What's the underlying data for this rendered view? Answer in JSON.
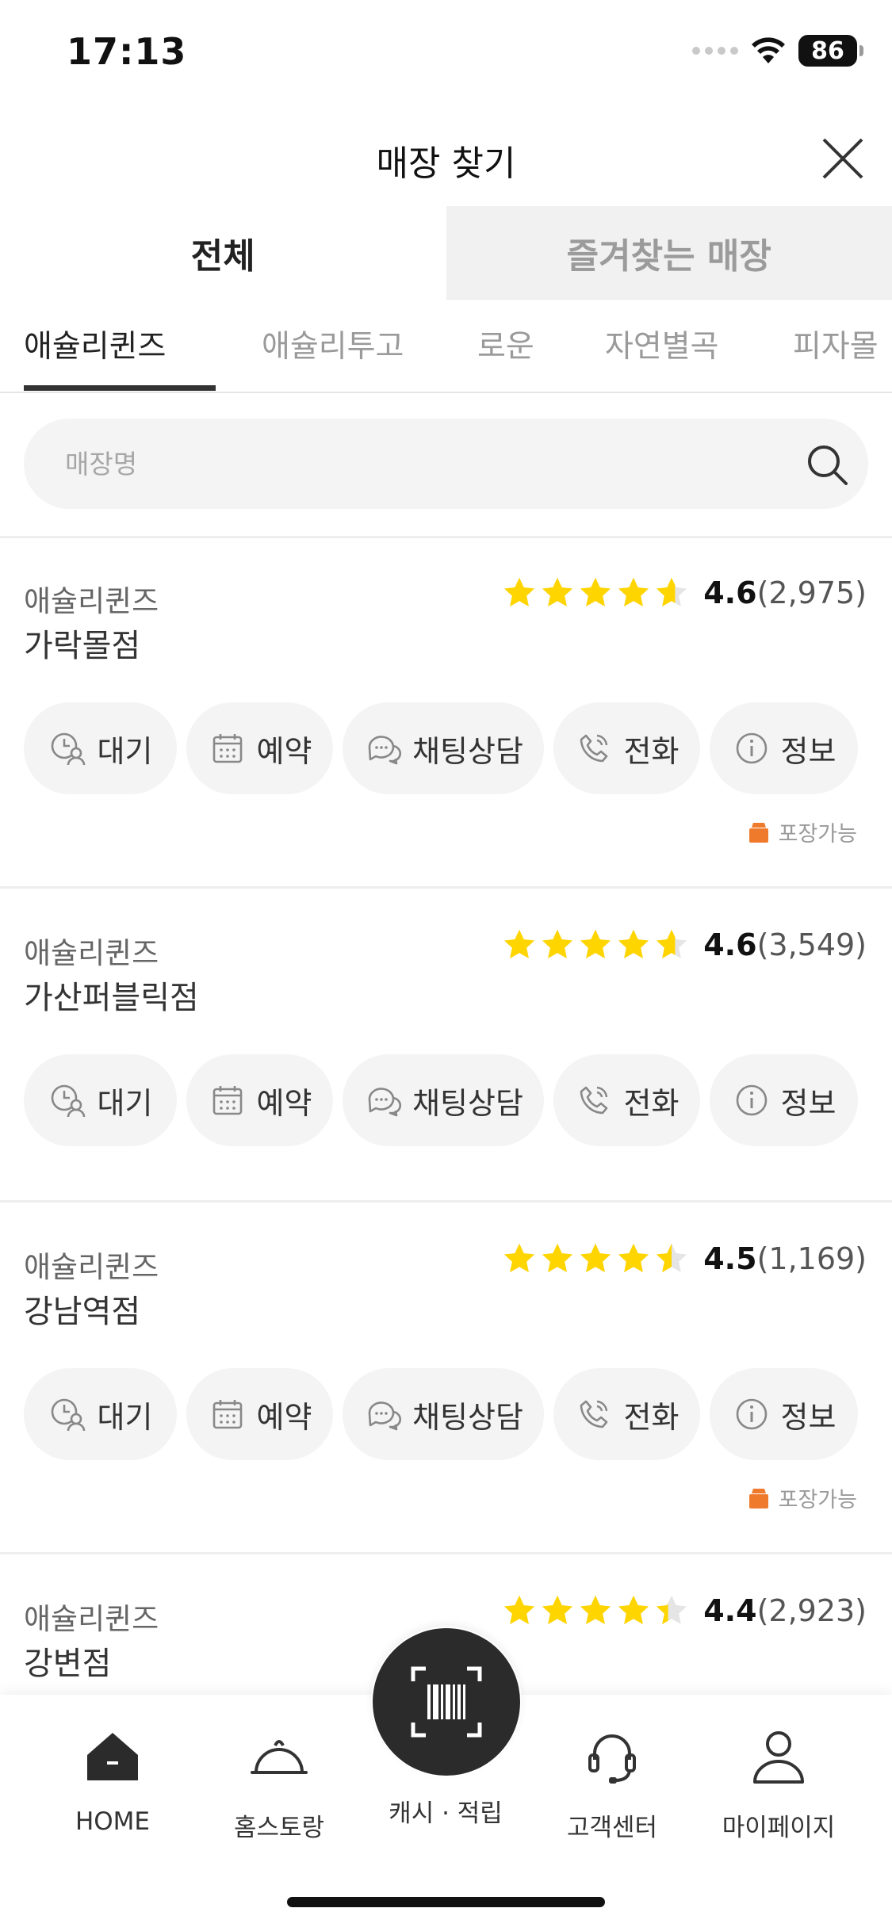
{
  "status_bar": {
    "time": "17:13",
    "battery": "86"
  },
  "header": {
    "title": "매장 찾기"
  },
  "top_tabs": [
    {
      "label": "전체",
      "active": true
    },
    {
      "label": "즐겨찾는 매장",
      "active": false
    }
  ],
  "brand_tabs": [
    {
      "label": "애슐리퀸즈",
      "active": true
    },
    {
      "label": "애슐리투고",
      "active": false
    },
    {
      "label": "로운",
      "active": false
    },
    {
      "label": "자연별곡",
      "active": false
    },
    {
      "label": "피자몰",
      "active": false
    }
  ],
  "search": {
    "placeholder": "매장명",
    "value": ""
  },
  "actions": {
    "wait": "대기",
    "reserve": "예약",
    "chat": "채팅상담",
    "call": "전화",
    "info": "정보"
  },
  "stores": [
    {
      "brand": "애슐리퀸즈",
      "name": "가락몰점",
      "rating": "4.6",
      "count": "(2,975)",
      "stars": 4.6,
      "takeout": "포장가능"
    },
    {
      "brand": "애슐리퀸즈",
      "name": "가산퍼블릭점",
      "rating": "4.6",
      "count": "(3,549)",
      "stars": 4.6
    },
    {
      "brand": "애슐리퀸즈",
      "name": "강남역점",
      "rating": "4.5",
      "count": "(1,169)",
      "stars": 4.5,
      "takeout": "포장가능"
    },
    {
      "brand": "애슐리퀸즈",
      "name": "강변점",
      "rating": "4.4",
      "count": "(2,923)",
      "stars": 4.4
    }
  ],
  "bottom_nav": {
    "home": "HOME",
    "restaurant": "홈스토랑",
    "cash": "캐시 · 적립",
    "support": "고객센터",
    "mypage": "마이페이지"
  },
  "colors": {
    "star": "#FFD500",
    "star_empty": "#E5E5E5",
    "takeout": "#F07A2C",
    "dark": "#2B2B2B"
  }
}
